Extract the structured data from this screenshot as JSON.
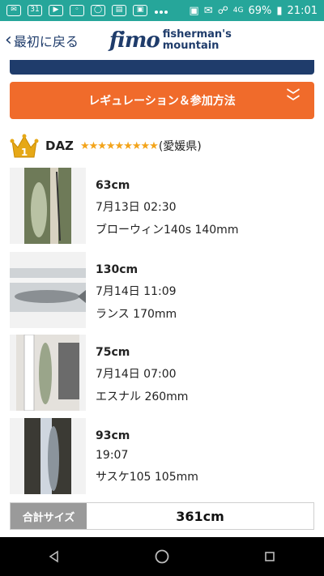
{
  "status_bar": {
    "calendar_day": "31",
    "battery": "69%",
    "time": "21:01",
    "signal_label": "4G"
  },
  "appbar": {
    "back_label": "最初に戻る",
    "logo": "fimo",
    "brand_line1": "fisherman's",
    "brand_line2": "mountain"
  },
  "regulation_button": {
    "label": "レギュレーション＆参加方法"
  },
  "rank": {
    "number": "1",
    "user": "DAZ",
    "stars": "★★★★★★★★★",
    "prefecture": "(愛媛県)"
  },
  "catches": [
    {
      "size": "63cm",
      "date": "7月13日 02:30",
      "lure": "ブローウィン140s 140mm"
    },
    {
      "size": "130cm",
      "date": "7月14日 11:09",
      "lure": "ランス 170mm"
    },
    {
      "size": "75cm",
      "date": "7月14日 07:00",
      "lure": "エスナル 260mm"
    },
    {
      "size": "93cm",
      "date": "19:07",
      "lure": "サスケ105 105mm"
    }
  ],
  "total": {
    "label": "合計サイズ",
    "value": "361cm"
  },
  "colors": {
    "status_bar": "#26a69a",
    "brand_navy": "#1f3c6b",
    "accent_orange": "#f06b2b",
    "star_gold": "#f3a41b"
  }
}
